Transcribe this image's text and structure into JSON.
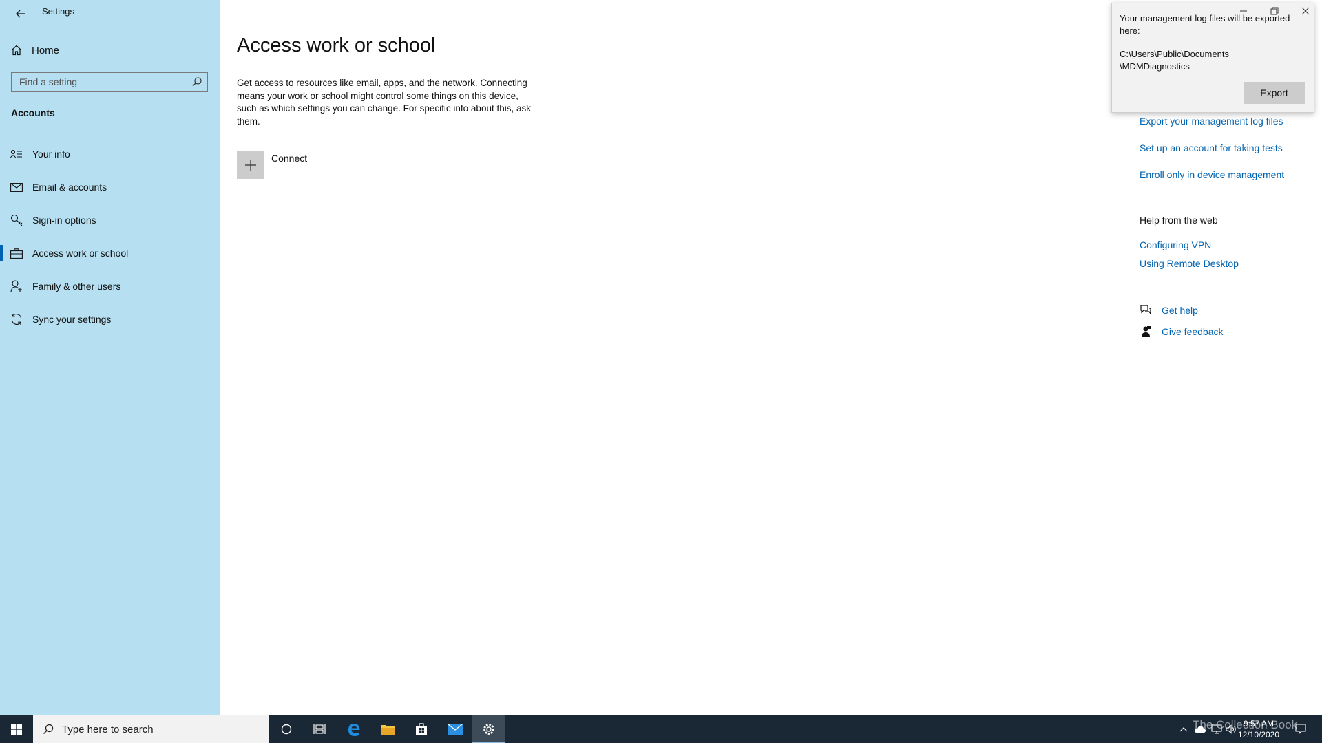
{
  "window": {
    "title": "Settings"
  },
  "sidebar": {
    "home_label": "Home",
    "search_placeholder": "Find a setting",
    "section_title": "Accounts",
    "items": [
      {
        "label": "Your info",
        "icon": "contact-card-icon"
      },
      {
        "label": "Email & accounts",
        "icon": "mail-icon"
      },
      {
        "label": "Sign-in options",
        "icon": "key-icon"
      },
      {
        "label": "Access work or school",
        "icon": "briefcase-icon",
        "active": true
      },
      {
        "label": "Family & other users",
        "icon": "person-add-icon"
      },
      {
        "label": "Sync your settings",
        "icon": "sync-icon"
      }
    ]
  },
  "main": {
    "title": "Access work or school",
    "description": "Get access to resources like email, apps, and the network. Connecting means your work or school might control some things on this device, such as which settings you can change. For specific info about this, ask them.",
    "connect_label": "Connect"
  },
  "related": {
    "links": [
      "Export your management log files",
      "Set up an account for taking tests",
      "Enroll only in device management"
    ],
    "help_heading": "Help from the web",
    "help_links": [
      "Configuring VPN",
      "Using Remote Desktop"
    ],
    "get_help": "Get help",
    "give_feedback": "Give feedback"
  },
  "popup": {
    "message": "Your management log files will be exported here:",
    "path_line1": "C:\\Users\\Public\\Documents",
    "path_line2": "\\MDMDiagnostics",
    "export_label": "Export"
  },
  "taskbar": {
    "search_placeholder": "Type here to search",
    "time": "9:57 AM",
    "date": "12/10/2020",
    "watermark": "The Collection Book"
  },
  "colors": {
    "sidebar": "#b6e0f1",
    "accent": "#0063b1",
    "taskbar": "#1a2735"
  }
}
